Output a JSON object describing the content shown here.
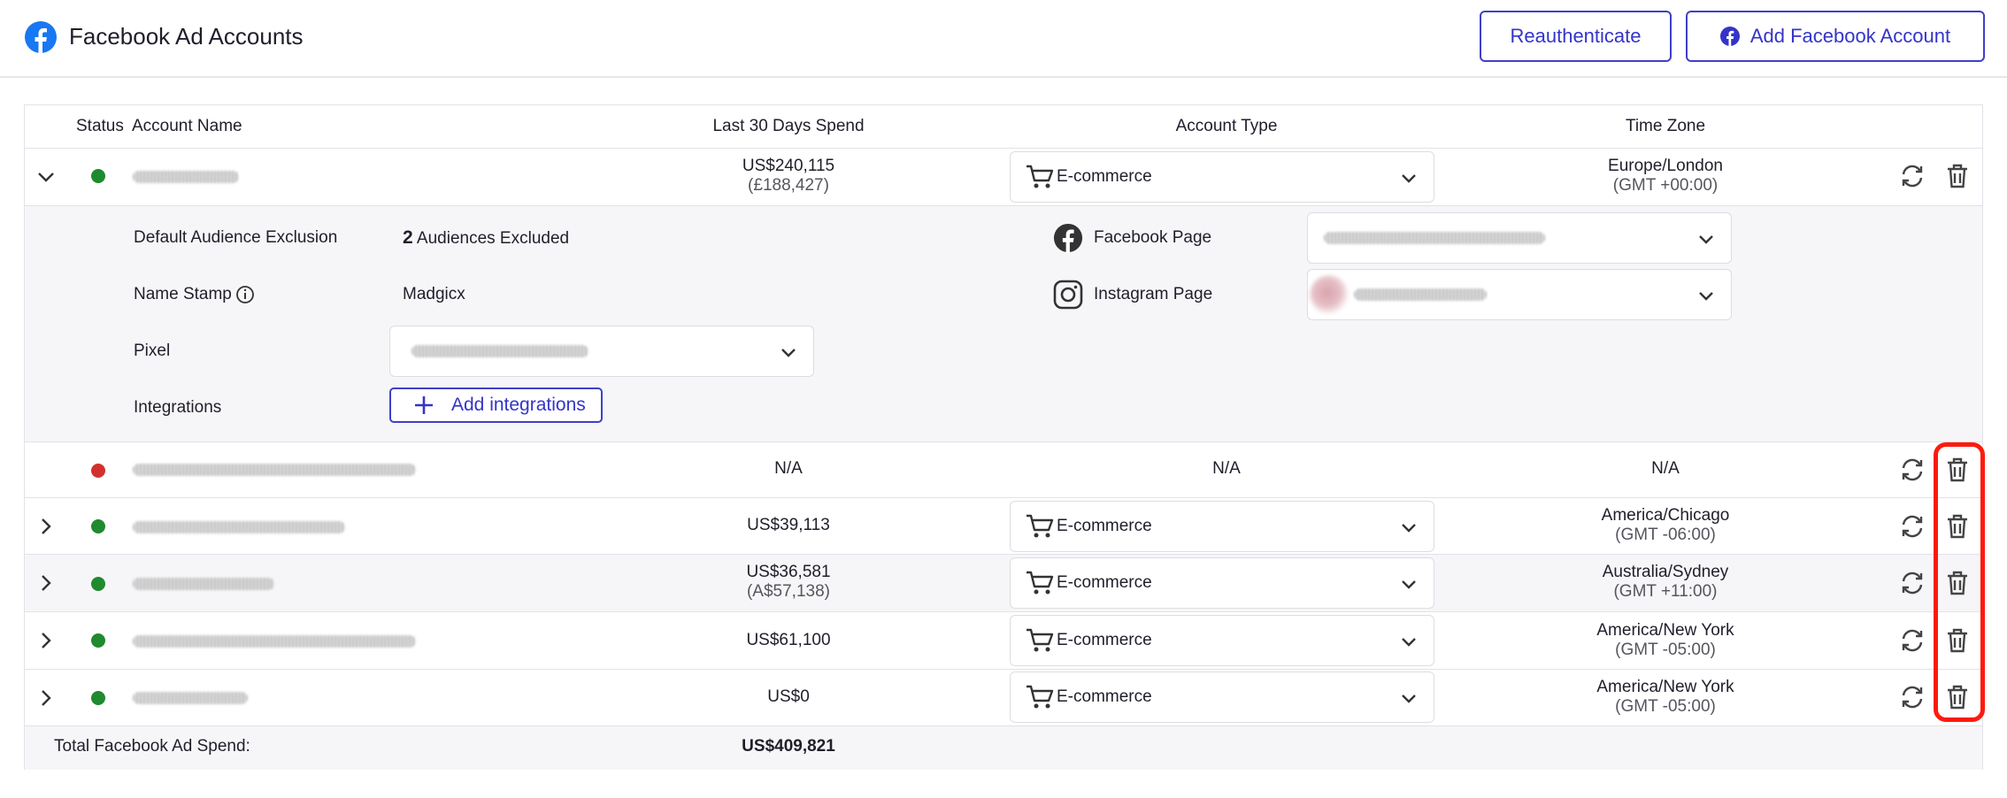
{
  "header": {
    "title": "Facebook Ad Accounts",
    "reauth_label": "Reauthenticate",
    "add_account_label": "Add Facebook Account"
  },
  "table": {
    "columns": [
      "Status",
      "Account Name",
      "Last 30 Days Spend",
      "Account Type",
      "Time Zone"
    ],
    "rows": [
      {
        "expanded": true,
        "status": "active",
        "spend": "US$240,115",
        "spend_local": "(£188,427)",
        "type": "E-commerce",
        "tz": "Europe/London",
        "tz_offset": "(GMT +00:00)"
      },
      {
        "expanded": false,
        "status": "inactive",
        "spend": "N/A",
        "type": "N/A",
        "tz": "N/A"
      },
      {
        "expanded": false,
        "status": "active",
        "spend": "US$39,113",
        "type": "E-commerce",
        "tz": "America/Chicago",
        "tz_offset": "(GMT -06:00)"
      },
      {
        "expanded": false,
        "status": "active",
        "spend": "US$36,581",
        "spend_local": "(A$57,138)",
        "type": "E-commerce",
        "tz": "Australia/Sydney",
        "tz_offset": "(GMT +11:00)"
      },
      {
        "expanded": false,
        "status": "active",
        "spend": "US$61,100",
        "type": "E-commerce",
        "tz": "America/New York",
        "tz_offset": "(GMT -05:00)"
      },
      {
        "expanded": false,
        "status": "active",
        "spend": "US$0",
        "type": "E-commerce",
        "tz": "America/New York",
        "tz_offset": "(GMT -05:00)"
      }
    ]
  },
  "details": {
    "audience_label": "Default Audience Exclusion",
    "audience_count": "2",
    "audience_text": "Audiences Excluded",
    "name_stamp_label": "Name Stamp",
    "name_stamp_value": "Madgicx",
    "pixel_label": "Pixel",
    "integrations_label": "Integrations",
    "add_integrations_label": "Add integrations",
    "facebook_page_label": "Facebook Page",
    "instagram_page_label": "Instagram Page"
  },
  "footer": {
    "total_label": "Total Facebook Ad Spend:",
    "total_value": "US$409,821"
  },
  "colors": {
    "accent": "#3434c9",
    "active": "#1f8a2e",
    "inactive": "#d2312f",
    "highlight": "#ff1a0e"
  },
  "icons": [
    "facebook-icon",
    "chevron-down-icon",
    "chevron-right-icon",
    "cart-icon",
    "refresh-icon",
    "trash-icon",
    "info-icon",
    "instagram-icon",
    "plus-icon"
  ]
}
